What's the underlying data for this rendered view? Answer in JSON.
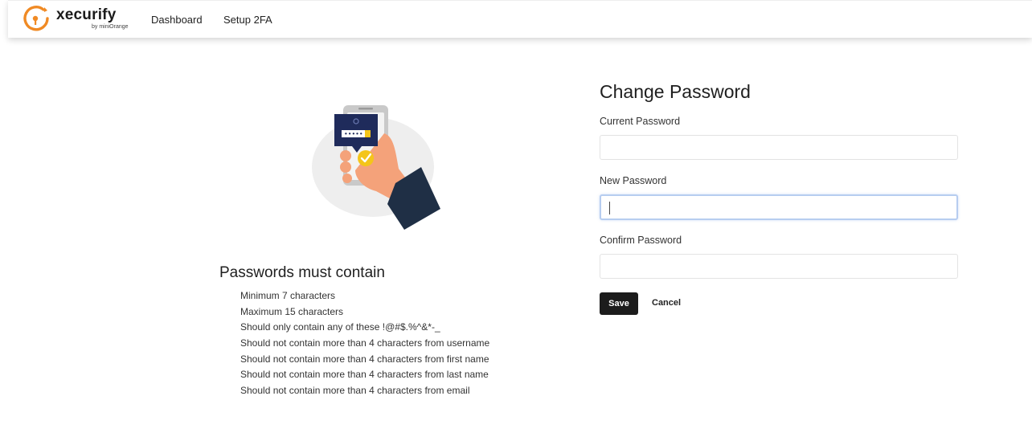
{
  "header": {
    "brand": "xecurify",
    "brand_sub": "by miniOrange",
    "nav": [
      "Dashboard",
      "Setup 2FA"
    ]
  },
  "colors": {
    "brand_orange": "#f08a24",
    "button_dark": "#1c1c1c",
    "illustration_navy": "#1f2b5b",
    "check_yellow": "#f4c51a"
  },
  "illustration": {
    "icon": "phone-password-illustration",
    "masked_value": "•••••"
  },
  "rules": {
    "title": "Passwords must contain",
    "items": [
      "Minimum 7 characters",
      "Maximum 15 characters",
      "Should only contain any of these !@#$.%^&*-_",
      "Should not contain more than 4 characters from username",
      "Should not contain more than 4 characters from first name",
      "Should not contain more than 4 characters from last name",
      "Should not contain more than 4 characters from email"
    ]
  },
  "form": {
    "title": "Change Password",
    "current_label": "Current Password",
    "new_label": "New Password",
    "confirm_label": "Confirm Password",
    "save_label": "Save",
    "cancel_label": "Cancel"
  }
}
